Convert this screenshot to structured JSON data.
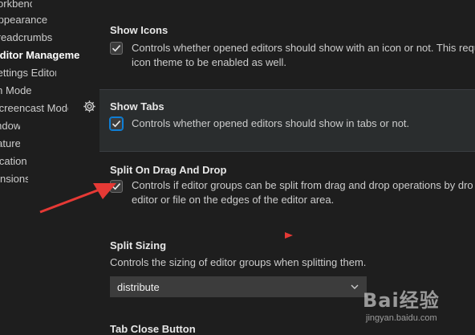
{
  "toc": {
    "items": [
      {
        "label": "Workbench"
      },
      {
        "label": "Appearance"
      },
      {
        "label": "Breadcrumbs"
      },
      {
        "label": "Editor Management"
      },
      {
        "label": "Settings Editor"
      },
      {
        "label": "Zen Mode"
      },
      {
        "label": "Screencast Mode"
      },
      {
        "label": "Window"
      },
      {
        "label": "Features"
      },
      {
        "label": "Application"
      },
      {
        "label": "Extensions"
      }
    ]
  },
  "settings": {
    "show_icons": {
      "title": "Show Icons",
      "desc_line1": "Controls whether opened editors should show with an icon or not. This requ",
      "desc_line2": "icon theme to be enabled as well.",
      "checked": true
    },
    "show_tabs": {
      "title": "Show Tabs",
      "desc": "Controls whether opened editors should show in tabs or not.",
      "checked": true
    },
    "split_drag": {
      "title": "Split On Drag And Drop",
      "desc_line1": "Controls if editor groups can be split from drag and drop operations by dro",
      "desc_line2": "editor or file on the edges of the editor area.",
      "checked": true
    },
    "split_sizing": {
      "title": "Split Sizing",
      "desc": "Controls the sizing of editor groups when splitting them.",
      "value": "distribute"
    },
    "tab_close": {
      "title": "Tab Close Button"
    }
  },
  "watermark": {
    "logo": "Bai经验",
    "url": "jingyan.baidu.com"
  },
  "colors": {
    "background": "#1e1e1e",
    "focused_row": "#2a2d2e",
    "checkbox_focus": "#0e7fd6",
    "annotation": "#e53935"
  }
}
